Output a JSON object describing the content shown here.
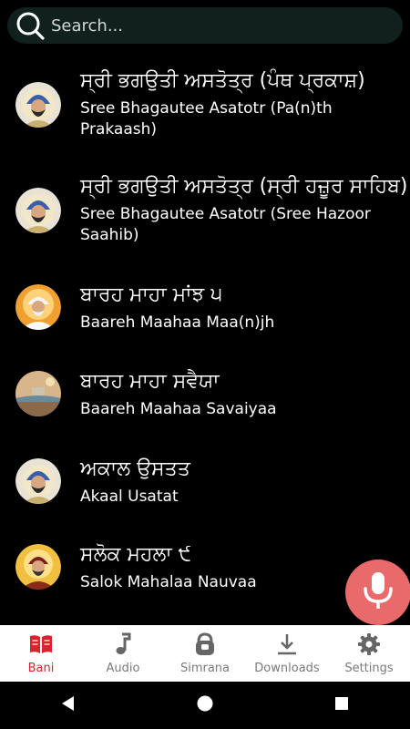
{
  "search": {
    "placeholder": "Search..."
  },
  "banis": [
    {
      "gurmukhi": "ਸ੍ਰੀ ਭਗਉਤੀ ਅਸਤੋਤ੍ਰ (ਪੰਥ ਪ੍ਰਕਾਸ਼)",
      "translit": "Sree Bhagautee Asatotr (Pa(n)th Prakaash)",
      "avatar": "guru-gobind-singh"
    },
    {
      "gurmukhi": "ਸ੍ਰੀ ਭਗਉਤੀ ਅਸਤੋਤ੍ਰ (ਸ੍ਰੀ ਹਜ਼ੂਰ ਸਾਹਿਬ)",
      "translit": "Sree Bhagautee Asatotr (Sree Hazoor Saahib)",
      "avatar": "guru-gobind-singh"
    },
    {
      "gurmukhi": "ਬਾਰਹ ਮਾਹਾ ਮਾਂਝ ੫",
      "translit": "Baareh Maahaa Maa(n)jh",
      "avatar": "guru-arjan-dev"
    },
    {
      "gurmukhi": "ਬਾਰਹ ਮਾਹਾ ਸਵੈਯਾ",
      "translit": "Baareh Maahaa Savaiyaa",
      "avatar": "landscape"
    },
    {
      "gurmukhi": "ਅਕਾਲ ਉਸਤਤ",
      "translit": "Akaal Usatat",
      "avatar": "guru-gobind-singh"
    },
    {
      "gurmukhi": "ਸਲੋਕ ਮਹਲਾ ੯",
      "translit": "Salok Mahalaa Nauvaa",
      "avatar": "guru-tegh-bahadur"
    }
  ],
  "nav": [
    {
      "label": "Bani",
      "icon": "book-icon",
      "active": true
    },
    {
      "label": "Audio",
      "icon": "music-note-icon",
      "active": false
    },
    {
      "label": "Simrana",
      "icon": "kettlebell-icon",
      "active": false
    },
    {
      "label": "Downloads",
      "icon": "download-icon",
      "active": false
    },
    {
      "label": "Settings",
      "icon": "gear-icon",
      "active": false
    }
  ],
  "colors": {
    "accent": "#d9232d",
    "mic": "#e96a6a",
    "search_bg": "#10201c",
    "background": "#000000"
  },
  "system_nav": [
    "back-icon",
    "home-icon",
    "recents-icon"
  ]
}
